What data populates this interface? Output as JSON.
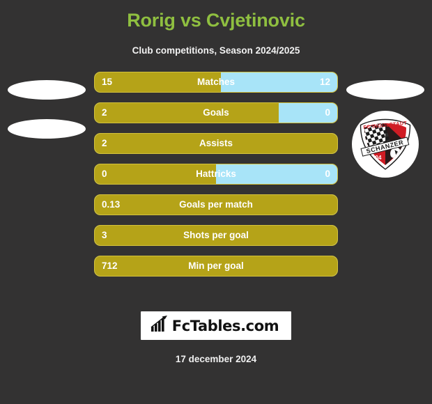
{
  "header": {
    "title": "Rorig vs Cvjetinovic",
    "subtitle": "Club competitions, Season 2024/2025"
  },
  "colors": {
    "background": "#333232",
    "title": "#8fbf40",
    "home_bar": "#b5a318",
    "away_bar": "#a8e4f8",
    "bar_border": "#d4c23c",
    "text": "#ffffff"
  },
  "teams": {
    "left": {
      "badge": "placeholder-ellipse",
      "badge_secondary": "placeholder-ellipse"
    },
    "right": {
      "badge": "placeholder-ellipse",
      "badge_club": "FC Ingolstadt 04 Schanzer",
      "badge_text_top": "FC INGOLSTADT",
      "badge_text_band": "SCHANZER",
      "badge_text_number": "04"
    }
  },
  "stats": [
    {
      "label": "Matches",
      "left": "15",
      "right": "12",
      "left_pct": 52
    },
    {
      "label": "Goals",
      "left": "2",
      "right": "0",
      "left_pct": 76
    },
    {
      "label": "Assists",
      "left": "2",
      "right": "",
      "left_pct": 100
    },
    {
      "label": "Hattricks",
      "left": "0",
      "right": "0",
      "left_pct": 50
    },
    {
      "label": "Goals per match",
      "left": "0.13",
      "right": "",
      "left_pct": 100
    },
    {
      "label": "Shots per goal",
      "left": "3",
      "right": "",
      "left_pct": 100
    },
    {
      "label": "Min per goal",
      "left": "712",
      "right": "",
      "left_pct": 100
    }
  ],
  "footer": {
    "logo_text": "FcTables.com",
    "logo_icon": "bar-chart-icon",
    "date": "17 december 2024"
  }
}
